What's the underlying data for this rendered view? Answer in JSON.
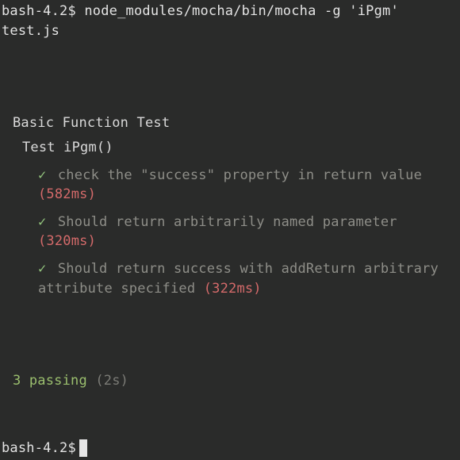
{
  "prompt1": {
    "ps1": "bash-4.2$",
    "command": "node_modules/mocha/bin/mocha -g 'iPgm' test.js"
  },
  "suite": {
    "title": "Basic Function Test",
    "subsuite": "Test iPgm()",
    "tests": [
      {
        "desc": "check the \"success\" property in return value",
        "duration": "(582ms)"
      },
      {
        "desc": "Should return arbitrarily named parameter",
        "duration": "(320ms)"
      },
      {
        "desc": "Should return success with addReturn arbitrary attribute specified",
        "duration": "(322ms)"
      }
    ]
  },
  "summary": {
    "passing": "3 passing",
    "time": "(2s)"
  },
  "prompt2": {
    "ps1": "bash-4.2$"
  },
  "glyphs": {
    "check": "✓"
  }
}
